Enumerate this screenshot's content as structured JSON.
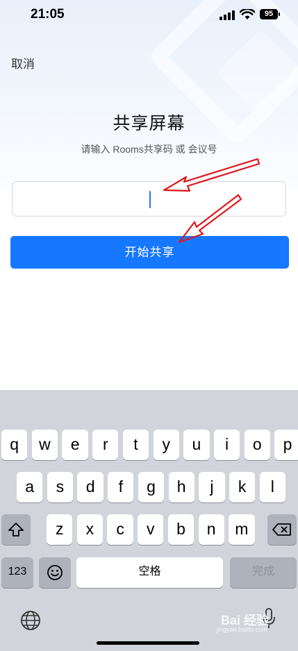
{
  "status_bar": {
    "time": "21:05",
    "battery": "95"
  },
  "header": {
    "cancel_label": "取消"
  },
  "main": {
    "title": "共享屏幕",
    "subtitle": "请输入 Rooms共享码 或 会议号",
    "input_value": "",
    "start_button_label": "开始共享"
  },
  "annotations": {
    "arrow_color": "#e0151b"
  },
  "keyboard": {
    "row1": [
      "q",
      "w",
      "e",
      "r",
      "t",
      "y",
      "u",
      "i",
      "o",
      "p"
    ],
    "row2": [
      "a",
      "s",
      "d",
      "f",
      "g",
      "h",
      "j",
      "k",
      "l"
    ],
    "row3": [
      "z",
      "x",
      "c",
      "v",
      "b",
      "n",
      "m"
    ],
    "numbers_label": "123",
    "space_label": "空格",
    "done_label": "完成"
  },
  "watermark": {
    "brand": "Bai 经验",
    "url": "jingyan.baidu.com"
  },
  "colors": {
    "accent": "#1677ff",
    "keyboard_bg": "#d1d4da"
  }
}
